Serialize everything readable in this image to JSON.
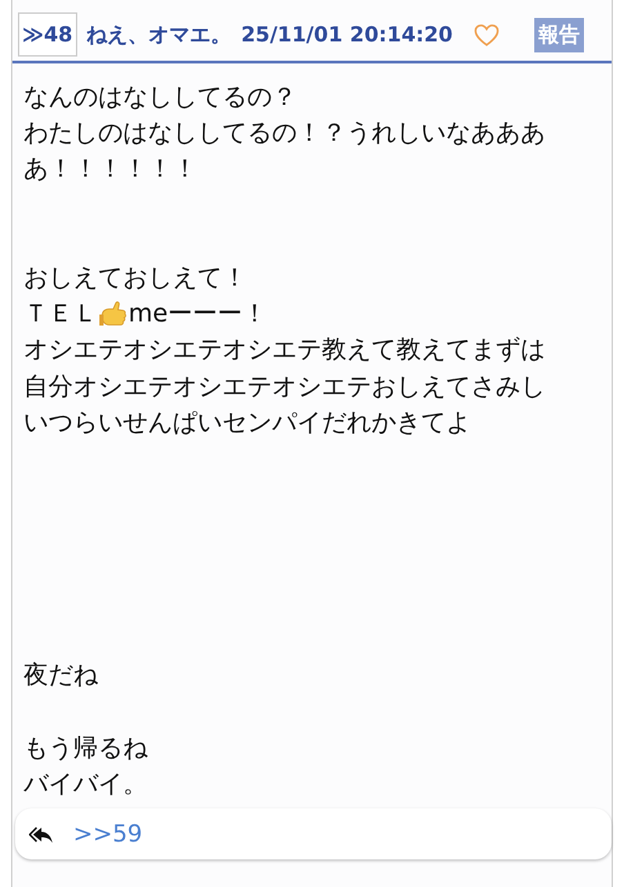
{
  "post": {
    "number": "≫48",
    "author": "ねえ、オマエ。",
    "datetime": "25/11/01 20:14:20",
    "liked": false,
    "report_label": "報告",
    "body": [
      {
        "kind": "text",
        "text": "なんのはなししてるの？"
      },
      {
        "kind": "text",
        "text": "わたしのはなししてるの！？うれしいなああああ！！！！！！"
      },
      {
        "kind": "blank"
      },
      {
        "kind": "blank"
      },
      {
        "kind": "text",
        "text": "おしえておしえて！"
      },
      {
        "kind": "emoji_line",
        "before": "ＴＥＬ",
        "after": "meーーー！"
      },
      {
        "kind": "text",
        "text": "オシエテオシエテオシエテ教えて教えてまずは自分オシエテオシエテオシエテおしえてさみしいつらいせんぱいセンパイだれかきてよ"
      },
      {
        "kind": "blank"
      },
      {
        "kind": "blank"
      },
      {
        "kind": "blank"
      },
      {
        "kind": "blank"
      },
      {
        "kind": "blank"
      },
      {
        "kind": "blank"
      },
      {
        "kind": "text",
        "text": "夜だね"
      },
      {
        "kind": "blank"
      },
      {
        "kind": "text",
        "text": "もう帰るね"
      },
      {
        "kind": "text",
        "text": "バイバイ。"
      }
    ],
    "replies": [
      ">>59"
    ]
  }
}
